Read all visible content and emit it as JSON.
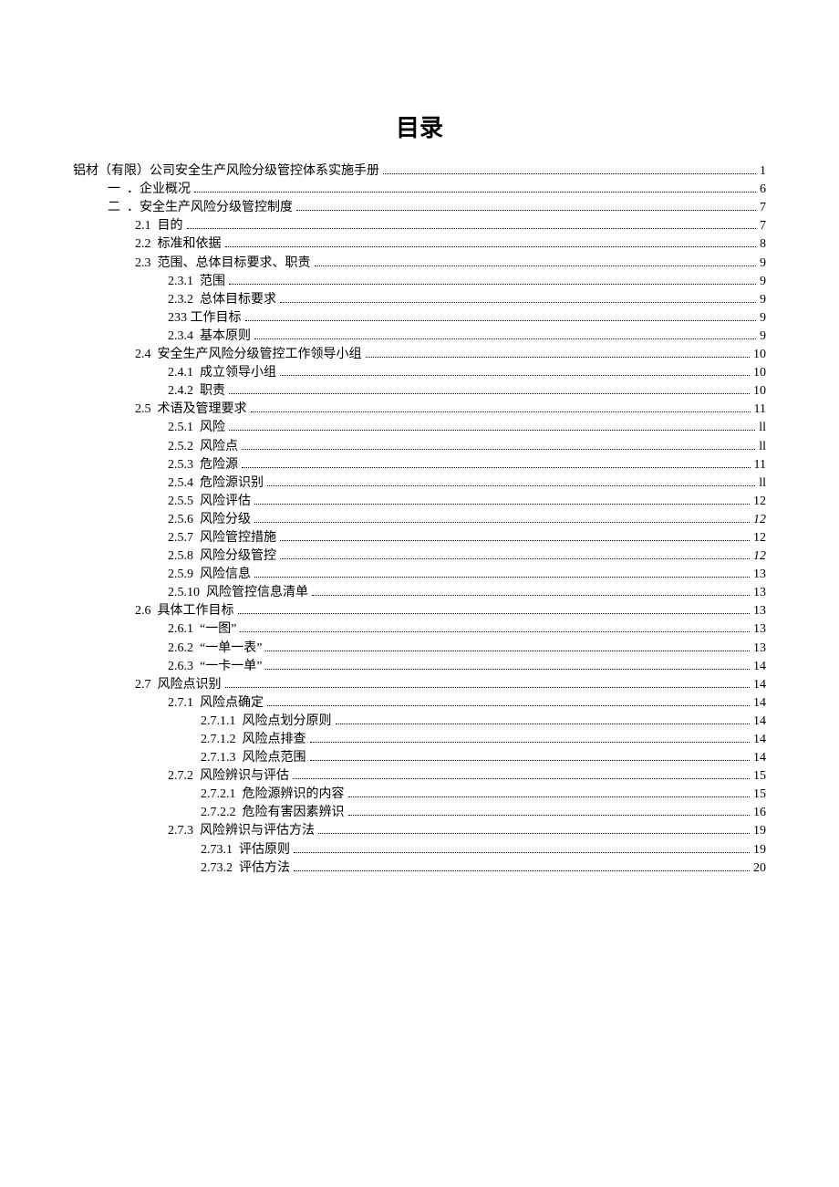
{
  "title": "目录",
  "entries": [
    {
      "indent": 0,
      "num": "",
      "text": "铝材（有限）公司安全生产风险分级管控体系实施手册",
      "page": "1",
      "sep": "  "
    },
    {
      "indent": 1,
      "num": "一",
      "text": "．企业概况",
      "page": "6",
      "sep": "  "
    },
    {
      "indent": 1,
      "num": "二",
      "text": "．安全生产风险分级管控制度",
      "page": "7",
      "sep": "  "
    },
    {
      "indent": 2,
      "num": "2.1",
      "text": "目的",
      "page": "7",
      "sep": "  "
    },
    {
      "indent": 2,
      "num": "2.2",
      "text": "标准和依据",
      "page": "8",
      "sep": "  "
    },
    {
      "indent": 2,
      "num": "2.3",
      "text": "范围、总体目标要求、职责",
      "page": "9",
      "sep": "  "
    },
    {
      "indent": 3,
      "num": "2.3.1",
      "text": "范围",
      "page": "9",
      "sep": "  "
    },
    {
      "indent": 3,
      "num": "2.3.2",
      "text": "总体目标要求",
      "page": "9",
      "sep": "  "
    },
    {
      "indent": 3,
      "num": "233",
      "text": "工作目标",
      "page": "9",
      "sep": " "
    },
    {
      "indent": 3,
      "num": "2.3.4",
      "text": "基本原则",
      "page": "9",
      "sep": "  "
    },
    {
      "indent": 2,
      "num": "2.4",
      "text": "安全生产风险分级管控工作领导小组",
      "page": "10",
      "sep": "  "
    },
    {
      "indent": 3,
      "num": "2.4.1",
      "text": "成立领导小组",
      "page": "10",
      "sep": "  "
    },
    {
      "indent": 3,
      "num": "2.4.2",
      "text": "职责",
      "page": "10",
      "sep": "  "
    },
    {
      "indent": 2,
      "num": "2.5",
      "text": "术语及管理要求",
      "page": "11",
      "sep": "  "
    },
    {
      "indent": 3,
      "num": "2.5.1",
      "text": "风险",
      "page": "ll",
      "sep": "  "
    },
    {
      "indent": 3,
      "num": "2.5.2",
      "text": "风险点",
      "page": "ll",
      "sep": "  "
    },
    {
      "indent": 3,
      "num": "2.5.3",
      "text": "危险源",
      "page": "11",
      "sep": "  "
    },
    {
      "indent": 3,
      "num": "2.5.4",
      "text": "危险源识别",
      "page": "ll",
      "sep": "  "
    },
    {
      "indent": 3,
      "num": "2.5.5",
      "text": "风险评估",
      "page": "12",
      "sep": "  "
    },
    {
      "indent": 3,
      "num": "2.5.6",
      "text": "风险分级",
      "page": "12",
      "sep": "  ",
      "italicPage": true
    },
    {
      "indent": 3,
      "num": "2.5.7",
      "text": "风险管控措施",
      "page": "12",
      "sep": "  "
    },
    {
      "indent": 3,
      "num": "2.5.8",
      "text": "风险分级管控",
      "page": "12",
      "sep": "  ",
      "italicPage": true
    },
    {
      "indent": 3,
      "num": "2.5.9",
      "text": "风险信息",
      "page": "13",
      "sep": "  "
    },
    {
      "indent": 3,
      "num": "2.5.10",
      "text": "风险管控信息清单",
      "page": "13",
      "sep": "  "
    },
    {
      "indent": 2,
      "num": "2.6",
      "text": "具体工作目标",
      "page": "13",
      "sep": "  "
    },
    {
      "indent": 3,
      "num": "2.6.1",
      "text": "一图",
      "page": "13",
      "sep": "  ",
      "quoted": true
    },
    {
      "indent": 3,
      "num": "2.6.2",
      "text": "一单一表",
      "page": "13",
      "sep": "  ",
      "quoted": true
    },
    {
      "indent": 3,
      "num": "2.6.3",
      "text": "一卡一单",
      "page": "14",
      "sep": "  ",
      "quoted": true
    },
    {
      "indent": 2,
      "num": "2.7",
      "text": "风险点识别",
      "page": "14",
      "sep": "  "
    },
    {
      "indent": 3,
      "num": "2.7.1",
      "text": "风险点确定",
      "page": "14",
      "sep": "  "
    },
    {
      "indent": 4,
      "num": "2.7.1.1",
      "text": "风险点划分原则",
      "page": "14",
      "sep": "  "
    },
    {
      "indent": 4,
      "num": "2.7.1.2",
      "text": "风险点排查",
      "page": "14",
      "sep": "  "
    },
    {
      "indent": 4,
      "num": "2.7.1.3",
      "text": "风险点范围",
      "page": "14",
      "sep": "  "
    },
    {
      "indent": 3,
      "num": "2.7.2",
      "text": "风险辨识与评估",
      "page": "15",
      "sep": "  "
    },
    {
      "indent": 4,
      "num": "2.7.2.1",
      "text": "危险源辨识的内容",
      "page": "15",
      "sep": "  "
    },
    {
      "indent": 4,
      "num": "2.7.2.2",
      "text": "危险有害因素辨识",
      "page": "16",
      "sep": "  "
    },
    {
      "indent": 3,
      "num": "2.7.3",
      "text": "风险辨识与评估方法",
      "page": "19",
      "sep": "  "
    },
    {
      "indent": 4,
      "num": "2.73.1",
      "text": "评估原则",
      "page": "19",
      "sep": "  "
    },
    {
      "indent": 4,
      "num": "2.73.2",
      "text": "评估方法",
      "page": "20",
      "sep": "  "
    }
  ]
}
